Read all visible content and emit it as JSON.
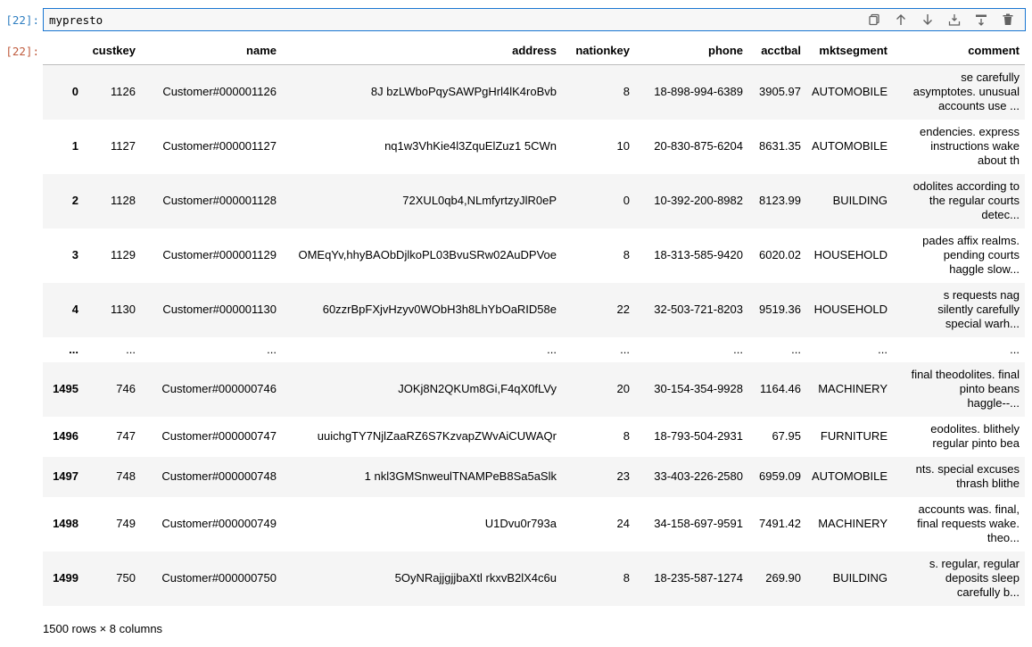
{
  "cell": {
    "input_prompt": "[22]:",
    "output_prompt": "[22]:",
    "code": "mypresto"
  },
  "toolbar": {
    "icons": [
      "duplicate-icon",
      "move-up-icon",
      "move-down-icon",
      "insert-above-icon",
      "insert-below-icon",
      "delete-icon"
    ]
  },
  "table": {
    "columns": [
      "custkey",
      "name",
      "address",
      "nationkey",
      "phone",
      "acctbal",
      "mktsegment",
      "comment"
    ],
    "rows": [
      {
        "idx": "0",
        "cells": [
          "1126",
          "Customer#000001126",
          "8J bzLWboPqySAWPgHrl4lK4roBvb",
          "8",
          "18-898-994-6389",
          "3905.97",
          "AUTOMOBILE",
          [
            "se carefully",
            "asymptotes. unusual",
            "accounts use ..."
          ]
        ]
      },
      {
        "idx": "1",
        "cells": [
          "1127",
          "Customer#000001127",
          "nq1w3VhKie4l3ZquElZuz1 5CWn",
          "10",
          "20-830-875-6204",
          "8631.35",
          "AUTOMOBILE",
          [
            "endencies. express",
            "instructions wake",
            "about th"
          ]
        ]
      },
      {
        "idx": "2",
        "cells": [
          "1128",
          "Customer#000001128",
          "72XUL0qb4,NLmfyrtzyJlR0eP",
          "0",
          "10-392-200-8982",
          "8123.99",
          "BUILDING",
          [
            "odolites according to",
            "the regular courts",
            "detec..."
          ]
        ]
      },
      {
        "idx": "3",
        "cells": [
          "1129",
          "Customer#000001129",
          "OMEqYv,hhyBAObDjlkoPL03BvuSRw02AuDPVoe",
          "8",
          "18-313-585-9420",
          "6020.02",
          "HOUSEHOLD",
          [
            "pades affix realms.",
            "pending courts",
            "haggle slow..."
          ]
        ]
      },
      {
        "idx": "4",
        "cells": [
          "1130",
          "Customer#000001130",
          "60zzrBpFXjvHzyv0WObH3h8LhYbOaRID58e",
          "22",
          "32-503-721-8203",
          "9519.36",
          "HOUSEHOLD",
          [
            "s requests nag",
            "silently carefully",
            "special warh..."
          ]
        ]
      },
      {
        "idx": "...",
        "cells": [
          "...",
          "...",
          "...",
          "...",
          "...",
          "...",
          "...",
          [
            "..."
          ]
        ]
      },
      {
        "idx": "1495",
        "cells": [
          "746",
          "Customer#000000746",
          "JOKj8N2QKUm8Gi,F4qX0fLVy",
          "20",
          "30-154-354-9928",
          "1164.46",
          "MACHINERY",
          [
            "final theodolites. final",
            "pinto beans",
            "haggle--..."
          ]
        ]
      },
      {
        "idx": "1496",
        "cells": [
          "747",
          "Customer#000000747",
          "uuichgTY7NjlZaaRZ6S7KzvapZWvAiCUWAQr",
          "8",
          "18-793-504-2931",
          "67.95",
          "FURNITURE",
          [
            "eodolites. blithely",
            "regular pinto bea"
          ]
        ]
      },
      {
        "idx": "1497",
        "cells": [
          "748",
          "Customer#000000748",
          "1 nkl3GMSnweulTNAMPeB8Sa5aSlk",
          "23",
          "33-403-226-2580",
          "6959.09",
          "AUTOMOBILE",
          [
            "nts. special excuses",
            "thrash blithe"
          ]
        ]
      },
      {
        "idx": "1498",
        "cells": [
          "749",
          "Customer#000000749",
          "U1Dvu0r793a",
          "24",
          "34-158-697-9591",
          "7491.42",
          "MACHINERY",
          [
            "accounts was. final,",
            "final requests wake.",
            "theo..."
          ]
        ]
      },
      {
        "idx": "1499",
        "cells": [
          "750",
          "Customer#000000750",
          "5OyNRajjgjjbaXtl rkxvB2lX4c6u",
          "8",
          "18-235-587-1274",
          "269.90",
          "BUILDING",
          [
            "s. regular, regular",
            "deposits sleep",
            "carefully b..."
          ]
        ]
      }
    ],
    "shape_text": "1500 rows × 8 columns"
  }
}
